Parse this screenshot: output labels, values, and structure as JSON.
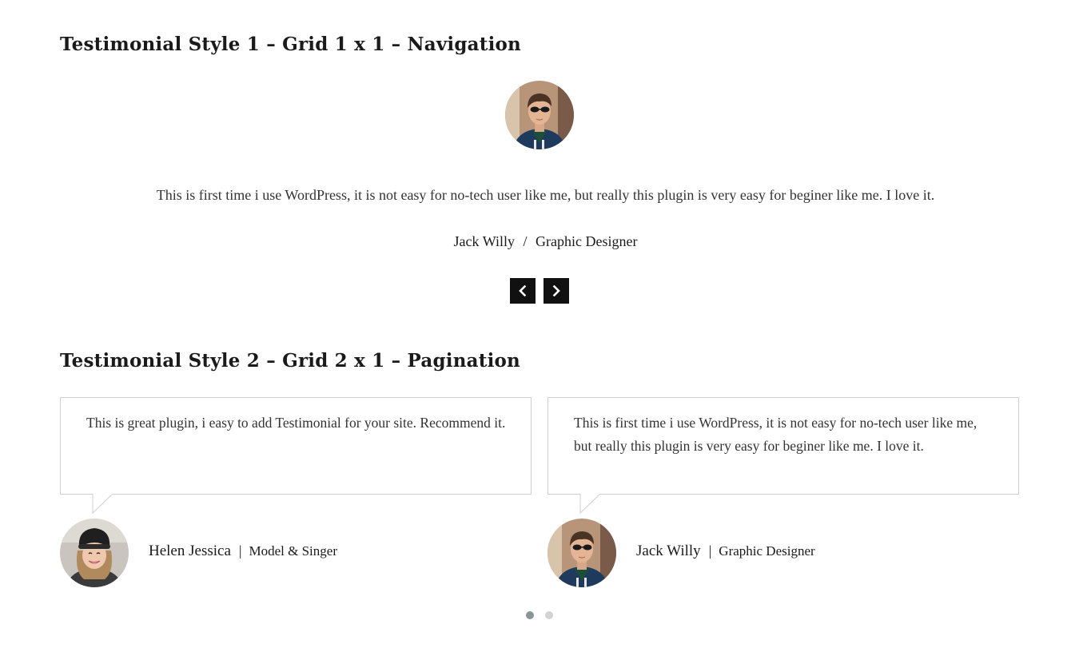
{
  "section1": {
    "title": "Testimonial Style 1 – Grid 1 x 1 – Navigation",
    "testimonial": {
      "quote": "This is first time i use WordPress, it is not easy for no-tech user like me, but really this plugin is very easy for beginer like me. I love it.",
      "name": "Jack Willy",
      "separator": "/",
      "role": "Graphic Designer"
    },
    "nav": {
      "prev_icon": "chevron-left-icon",
      "next_icon": "chevron-right-icon"
    }
  },
  "section2": {
    "title": "Testimonial Style 2 – Grid 2 x 1 – Pagination",
    "testimonials": [
      {
        "quote": "This is great plugin, i easy to add Testimonial for your site. Recommend it.",
        "name": "Helen Jessica",
        "separator": "|",
        "role": "Model & Singer"
      },
      {
        "quote": "This is first time i use WordPress, it is not easy for no-tech user like me, but really this plugin is very easy for beginer like me. I love it.",
        "name": "Jack Willy",
        "separator": "|",
        "role": "Graphic Designer"
      }
    ],
    "pagination": {
      "pages": 2,
      "active": 1
    }
  },
  "colors": {
    "text": "#1a1a1a",
    "nav_button": "#111111",
    "card_border": "#cfcfcf",
    "dot_active": "#8a9694",
    "dot_inactive": "#d3d3d3"
  }
}
